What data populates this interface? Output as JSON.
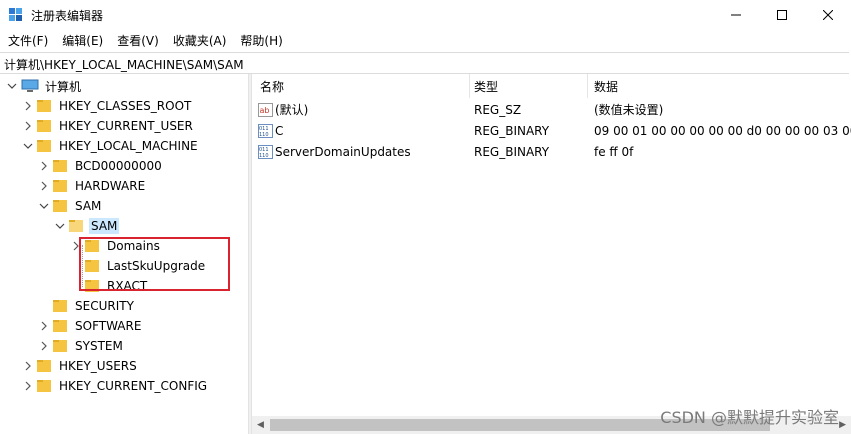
{
  "window": {
    "title": "注册表编辑器",
    "controls": [
      "minimize",
      "maximize",
      "close"
    ]
  },
  "menu": [
    "文件(F)",
    "编辑(E)",
    "查看(V)",
    "收藏夹(A)",
    "帮助(H)"
  ],
  "address": "计算机\\HKEY_LOCAL_MACHINE\\SAM\\SAM",
  "tree": {
    "root": "计算机",
    "hives": [
      "HKEY_CLASSES_ROOT",
      "HKEY_CURRENT_USER",
      "HKEY_LOCAL_MACHINE"
    ],
    "hklm_children": [
      "BCD00000000",
      "HARDWARE",
      "SAM"
    ],
    "sam_child": "SAM",
    "sam_sam_children": [
      "Domains",
      "LastSkuUpgrade",
      "RXACT"
    ],
    "hklm_after": [
      "SECURITY",
      "SOFTWARE",
      "SYSTEM"
    ],
    "hives_after": [
      "HKEY_USERS",
      "HKEY_CURRENT_CONFIG"
    ]
  },
  "columns": {
    "name": "名称",
    "type": "类型",
    "data": "数据"
  },
  "values": [
    {
      "name": "(默认)",
      "type": "REG_SZ",
      "data": "(数值未设置)",
      "icon": "string-value-icon"
    },
    {
      "name": "C",
      "type": "REG_BINARY",
      "data": "09 00 01 00 00 00 00 00 d0 00 00 00 03 00 0",
      "icon": "binary-value-icon"
    },
    {
      "name": "ServerDomainUpdates",
      "type": "REG_BINARY",
      "data": "fe ff 0f",
      "icon": "binary-value-icon"
    }
  ],
  "colors": {
    "selection": "#cce8ff",
    "folder": "#f5c542",
    "highlight_box": "#d9232e"
  },
  "watermark": "CSDN @默默提升实验室"
}
